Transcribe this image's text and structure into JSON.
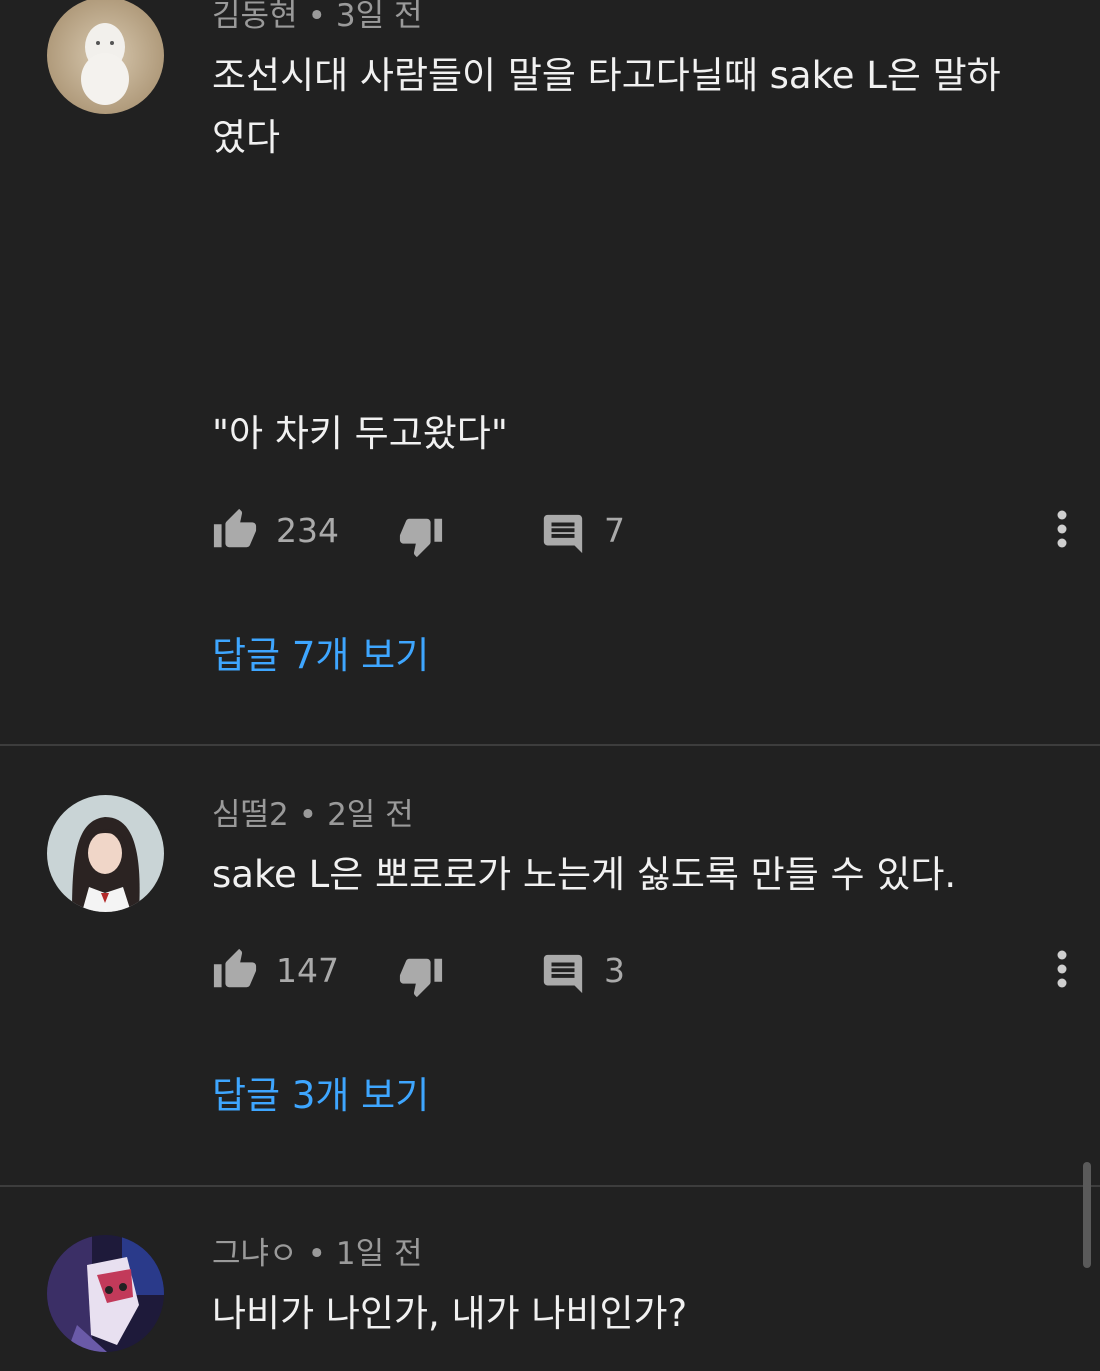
{
  "comments": [
    {
      "author": "김동현",
      "time": "3일 전",
      "text": "조선시대 사람들이 말을 타고다닐때 sake L은 말하\n였다",
      "text2": "\"아 차키 두고왔다\"",
      "likes": "234",
      "reply_count": "7",
      "replies_label": "답글 7개 보기",
      "avatar_icon": "hamster-avatar"
    },
    {
      "author": "심떨2",
      "time": "2일 전",
      "text": "sake L은 뽀로로가 노는게 싫도록 만들 수 있다.",
      "likes": "147",
      "reply_count": "3",
      "replies_label": "답글 3개 보기",
      "avatar_icon": "girl-avatar"
    },
    {
      "author": "그냐ㅇ",
      "time": "1일 전",
      "text": "나비가 나인가, 내가 나비인가?",
      "avatar_icon": "anime-avatar"
    }
  ],
  "separator": "•",
  "icons": {
    "like": "thumbs-up-icon",
    "dislike": "thumbs-down-icon",
    "reply": "comment-icon",
    "more": "more-vertical-icon"
  },
  "colors": {
    "background": "#212121",
    "link": "#3ea6ff",
    "meta": "#9a9a9a"
  }
}
